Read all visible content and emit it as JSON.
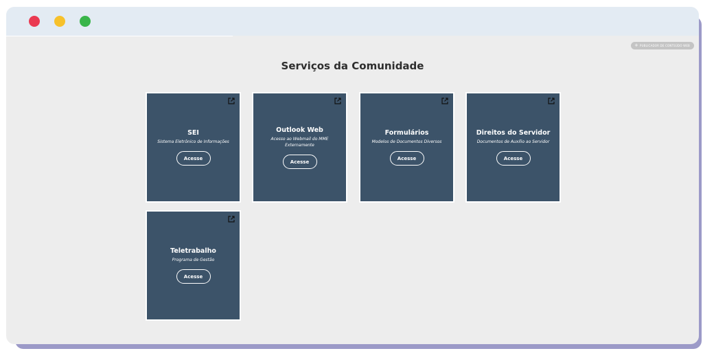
{
  "publisher": {
    "label": "PUBLICADOR DE CONTEÚDO WEB"
  },
  "page": {
    "title": "Serviços da Comunidade"
  },
  "cards": [
    {
      "title": "SEI",
      "subtitle": "Sistema Eletrônico de Informações",
      "button": "Acesse"
    },
    {
      "title": "Outlook Web",
      "subtitle": "Acesso ao Webmail do MME Externamente",
      "button": "Acesse"
    },
    {
      "title": "Formulários",
      "subtitle": "Modelos de Documentos Diversos",
      "button": "Acesse"
    },
    {
      "title": "Direitos do Servidor",
      "subtitle": "Documentos de Auxílio ao Servidor",
      "button": "Acesse"
    },
    {
      "title": "Teletrabalho",
      "subtitle": "Programa de Gestão",
      "button": "Acesse"
    }
  ],
  "colors": {
    "card_background": "#3c5369",
    "close_dot": "#ea3a52",
    "minimize_dot": "#f7c12b",
    "maximize_dot": "#39b54a"
  }
}
